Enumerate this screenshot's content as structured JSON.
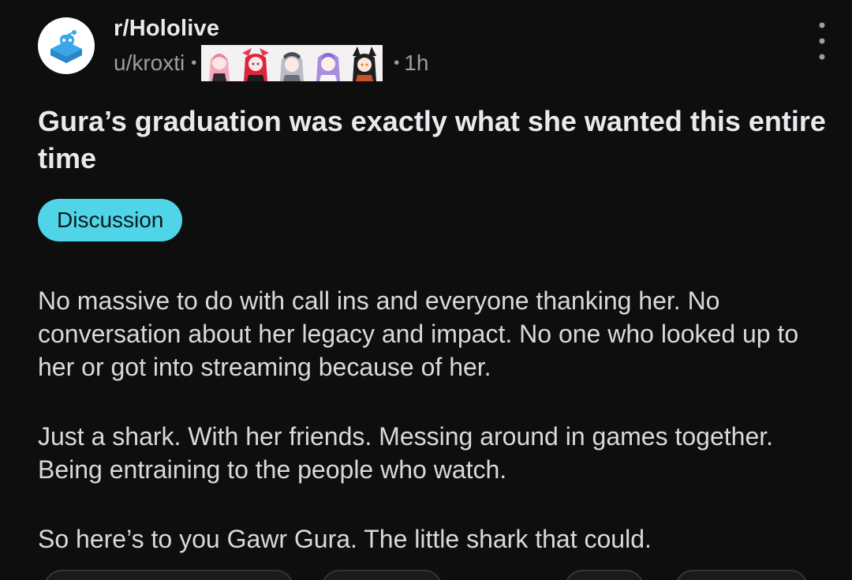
{
  "post": {
    "subreddit": "r/Hololive",
    "author": "u/kroxti",
    "separator": "•",
    "age": "1h",
    "title": "Gura’s graduation was exactly what she wanted this entire time",
    "flair": "Discussion",
    "body": [
      "No massive to do with call ins and everyone thanking her. No conversation about her legacy and impact. No one who looked up to her or got into streaming because of her.",
      "Just a shark. With her friends. Messing around in games together. Being entraining to the people who watch.",
      "So here’s to you Gawr Gura. The little shark that could."
    ]
  },
  "icons": {
    "subreddit_avatar": "hololive-logo-icon",
    "user_flair": "vtuber-emote-flair-icons",
    "overflow": "vertical-dots-icon"
  },
  "colors": {
    "background": "#0e0e0f",
    "flair_bg": "#4fd4e8",
    "text": "#d7dadc",
    "muted": "#9a9ea3"
  }
}
